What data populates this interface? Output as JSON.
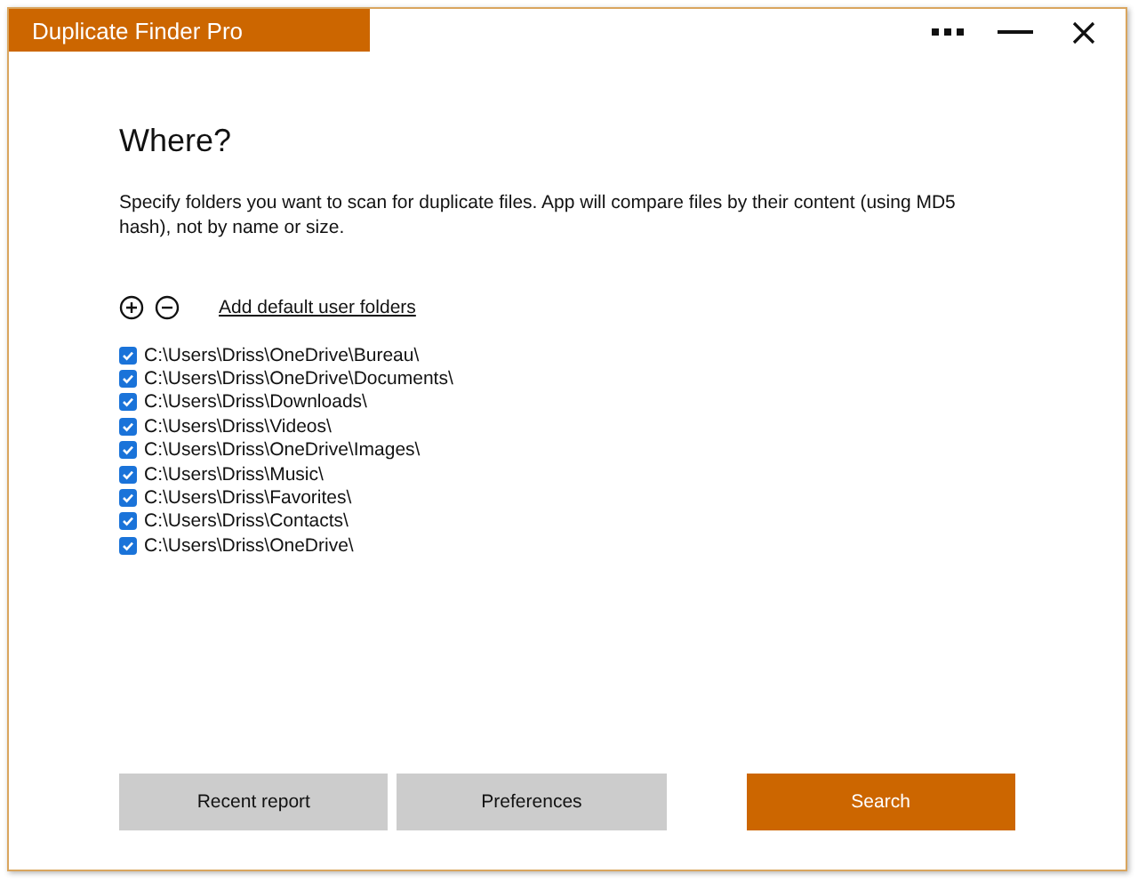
{
  "window": {
    "title": "Duplicate Finder Pro",
    "controls": [
      {
        "kind": "more"
      },
      {
        "kind": "minimize"
      },
      {
        "kind": "close"
      }
    ]
  },
  "heading": "Where?",
  "description": "Specify folders you want to scan for duplicate files. App will compare files by their content (using MD5 hash), not by name or size.",
  "folder_tools": {
    "link": "Add default user folders"
  },
  "folders": [
    {
      "path": "C:\\Users\\Driss\\OneDrive\\Bureau\\",
      "checked": true
    },
    {
      "path": "C:\\Users\\Driss\\OneDrive\\Documents\\",
      "checked": true
    },
    {
      "path": "C:\\Users\\Driss\\Downloads\\",
      "checked": true
    },
    {
      "path": "C:\\Users\\Driss\\Videos\\",
      "checked": true
    },
    {
      "path": "C:\\Users\\Driss\\OneDrive\\Images\\",
      "checked": true
    },
    {
      "path": "C:\\Users\\Driss\\Music\\",
      "checked": true
    },
    {
      "path": "C:\\Users\\Driss\\Favorites\\",
      "checked": true
    },
    {
      "path": "C:\\Users\\Driss\\Contacts\\",
      "checked": true
    },
    {
      "path": "C:\\Users\\Driss\\OneDrive\\",
      "checked": true
    }
  ],
  "buttons": [
    {
      "label": "Recent report",
      "kind": "secondary"
    },
    {
      "label": "Preferences",
      "kind": "secondary"
    },
    {
      "label": "Search",
      "kind": "primary"
    }
  ]
}
